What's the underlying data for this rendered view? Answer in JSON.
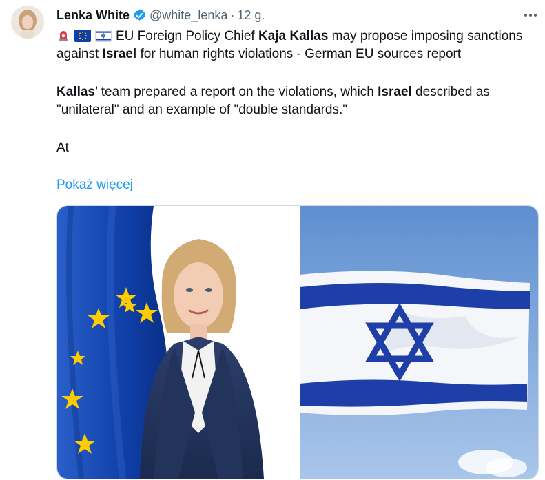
{
  "author": {
    "name": "Lenka White",
    "handle": "@white_lenka",
    "separator": "·",
    "time": "12 g."
  },
  "tweet": {
    "flags": [
      "siren-emoji",
      "eu-flag-emoji",
      "israel-flag-emoji"
    ],
    "p1": {
      "t1": "EU Foreign Policy Chief ",
      "b1": "Kaja Kallas",
      "t2": " may propose imposing sanctions against ",
      "b2": "Israel",
      "t3": " for human rights violations - German EU sources report"
    },
    "p2": {
      "b1": "Kallas",
      "t1": "’ team prepared a report on the violations, which ",
      "b2": "Israel",
      "t2": " described as \"unilateral\" and an example of \"double standards.\""
    },
    "p3": "At",
    "show_more": "Pokaż więcej"
  },
  "icons": {
    "verified": "verified-badge-icon",
    "more": "more-options-icon"
  },
  "colors": {
    "link": "#1d9bf0",
    "verified": "#1d9bf0",
    "secondary_text": "#536471",
    "eu_blue": "#0f3fa8",
    "eu_star": "#ffcc00",
    "israel_blue": "#1f3fa8",
    "sky": "#6f9bd6"
  }
}
